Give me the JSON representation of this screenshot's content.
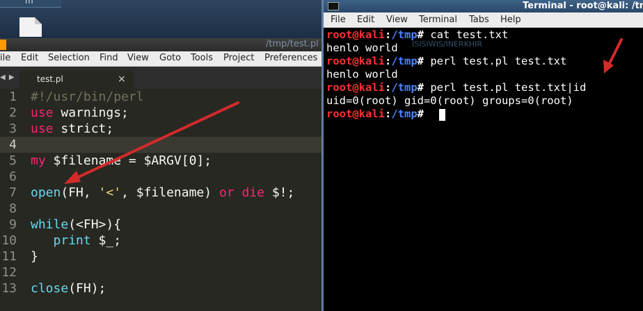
{
  "desktop": {
    "launcher_glyph": "m",
    "file_icon": "document-icon"
  },
  "editor": {
    "title": "/tmp/test.pl",
    "menu": [
      "ile",
      "Edit",
      "Selection",
      "Find",
      "View",
      "Goto",
      "Tools",
      "Project",
      "Preferences"
    ],
    "tab_nav": "◀ ▶",
    "tab_name": "test.pl",
    "tab_close": "×",
    "line_numbers": [
      "1",
      "2",
      "3",
      "4",
      "5",
      "6",
      "7",
      "8",
      "9",
      "10",
      "11",
      "12",
      "13"
    ],
    "current_line": "4",
    "code": {
      "l1": "#!/usr/bin/perl",
      "l2_kw": "use",
      "l2_rest": " warnings;",
      "l3_kw": "use",
      "l3_rest": " strict;",
      "l5_kw": "my",
      "l5_rest": " $filename = $ARGV[0];",
      "l7_fn": "open",
      "l7_a": "(FH, ",
      "l7_str": "'<'",
      "l7_b": ", $filename) ",
      "l7_or": "or",
      "l7_sp": " ",
      "l7_die": "die",
      "l7_c": " $!;",
      "l9_fn": "while",
      "l9_rest": "(<FH>){",
      "l10_pad": "   ",
      "l10_fn": "print",
      "l10_rest": " $_;",
      "l11": "}",
      "l13_fn": "close",
      "l13_rest": "(FH);"
    }
  },
  "terminal": {
    "title": "Terminal - root@kali: /tmp",
    "menu": [
      "File",
      "Edit",
      "View",
      "Terminal",
      "Tabs",
      "Help"
    ],
    "prompt_user": "root@kali",
    "prompt_sep": ":",
    "prompt_path": "/tmp",
    "prompt_end": "#",
    "lines": [
      {
        "cmd": " cat test.txt"
      },
      {
        "out": "henlo world"
      },
      {
        "cmd": " perl test.pl test.txt"
      },
      {
        "out": "henlo world"
      },
      {
        "cmd": " perl test.pl test.txt|id"
      },
      {
        "out": "uid=0(root) gid=0(root) groups=0(root)"
      }
    ],
    "ghost_text": "ISISIWIS/INERKHIR"
  },
  "colors": {
    "arrow": "#d42a2a",
    "prompt_user": "#ff3131",
    "prompt_path": "#4a84ff"
  }
}
